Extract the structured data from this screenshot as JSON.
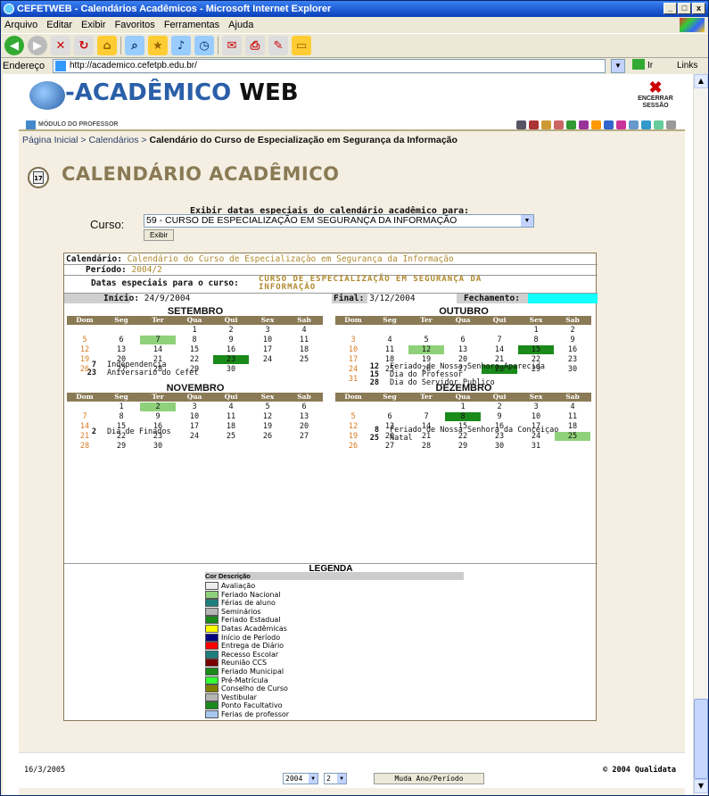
{
  "window": {
    "title": "CEFETWEB - Calendários Acadêmicos - Microsoft Internet Explorer",
    "controls": [
      "_",
      "□",
      "x"
    ]
  },
  "menu": [
    "Arquivo",
    "Editar",
    "Exibir",
    "Favoritos",
    "Ferramentas",
    "Ajuda"
  ],
  "address": {
    "label": "Endereço",
    "url": "http://academico.cefetpb.edu.br/",
    "go": "Ir",
    "links": "Links"
  },
  "header": {
    "logo_prefix": "-ACADÊMICO",
    "logo_suffix": "WEB",
    "logout_label": "ENCERRAR SESSÃO",
    "module": "MÓDULO DO PROFESSOR"
  },
  "breadcrumb": {
    "home": "Página Inicial",
    "sep1": ">",
    "calendars": "Calendários",
    "sep2": ">",
    "current": "Calendário do Curso de Especialização em Segurança da Informação"
  },
  "page_title": "CALENDÁRIO ACADÊMICO",
  "calendar_icon_text": "17",
  "filter": {
    "label": "Exibir datas especiais do calendário acadêmico para:",
    "course_label": "Curso:",
    "course_value": "59 - CURSO DE ESPECIALIZAÇÃO EM SEGURANÇA DA INFORMAÇÃO",
    "button": "Exibir"
  },
  "info": {
    "calendar_label": "Calendário:",
    "calendar_value": "Calendário do Curso de Especialização em Segurança da Informação",
    "period_label": "Período:",
    "period_value": "2004/2",
    "special_label": "Datas especiais para o curso:",
    "special_value": "CURSO DE ESPECIALIZAÇÃO EM SEGURANÇA DA INFORMAÇÃO",
    "start_label": "Início:",
    "start_value": "24/9/2004",
    "end_label": "Final:",
    "end_value": "3/12/2004",
    "close_label": "Fechamento:",
    "close_value": ""
  },
  "weekdays": [
    "Dom",
    "Seg",
    "Ter",
    "Qua",
    "Qui",
    "Sex",
    "Sab"
  ],
  "months": [
    {
      "name": "SETEMBRO",
      "weeks": [
        [
          "",
          "",
          "",
          "1",
          "2",
          "3",
          "4"
        ],
        [
          "5",
          "6",
          "7",
          "8",
          "9",
          "10",
          "11"
        ],
        [
          "12",
          "13",
          "14",
          "15",
          "16",
          "17",
          "18"
        ],
        [
          "19",
          "20",
          "21",
          "22",
          "23",
          "24",
          "25"
        ],
        [
          "26",
          "27",
          "28",
          "29",
          "30",
          "",
          ""
        ]
      ],
      "highlights": {
        "7": "light",
        "23": "dark"
      },
      "holidays": [
        {
          "day": "7",
          "desc": "Independencia"
        },
        {
          "day": "23",
          "desc": "Aniversario do Cefet"
        }
      ]
    },
    {
      "name": "OUTUBRO",
      "weeks": [
        [
          "",
          "",
          "",
          "",
          "",
          "1",
          "2"
        ],
        [
          "3",
          "4",
          "5",
          "6",
          "7",
          "8",
          "9"
        ],
        [
          "10",
          "11",
          "12",
          "13",
          "14",
          "15",
          "16"
        ],
        [
          "17",
          "18",
          "19",
          "20",
          "21",
          "22",
          "23"
        ],
        [
          "24",
          "25",
          "26",
          "27",
          "28",
          "29",
          "30"
        ],
        [
          "31",
          "",
          "",
          "",
          "",
          "",
          ""
        ]
      ],
      "highlights": {
        "12": "light",
        "15": "dark",
        "28": "dark"
      },
      "holidays": [
        {
          "day": "12",
          "desc": "Feriado de Nossa Senhora Aparecida"
        },
        {
          "day": "15",
          "desc": "Dia do Professor"
        },
        {
          "day": "28",
          "desc": "Dia do Servidor Publico"
        }
      ]
    },
    {
      "name": "NOVEMBRO",
      "weeks": [
        [
          "",
          "1",
          "2",
          "3",
          "4",
          "5",
          "6"
        ],
        [
          "7",
          "8",
          "9",
          "10",
          "11",
          "12",
          "13"
        ],
        [
          "14",
          "15",
          "16",
          "17",
          "18",
          "19",
          "20"
        ],
        [
          "21",
          "22",
          "23",
          "24",
          "25",
          "26",
          "27"
        ],
        [
          "28",
          "29",
          "30",
          "",
          "",
          "",
          ""
        ]
      ],
      "highlights": {
        "2": "light"
      },
      "holidays": [
        {
          "day": "2",
          "desc": "Dia de Finados"
        }
      ]
    },
    {
      "name": "DEZEMBRO",
      "weeks": [
        [
          "",
          "",
          "",
          "1",
          "2",
          "3",
          "4"
        ],
        [
          "5",
          "6",
          "7",
          "8",
          "9",
          "10",
          "11"
        ],
        [
          "12",
          "13",
          "14",
          "15",
          "16",
          "17",
          "18"
        ],
        [
          "19",
          "20",
          "21",
          "22",
          "23",
          "24",
          "25"
        ],
        [
          "26",
          "27",
          "28",
          "29",
          "30",
          "31",
          ""
        ]
      ],
      "highlights": {
        "8": "dark",
        "25": "light"
      },
      "holidays": [
        {
          "day": "8",
          "desc": "Feriado de Nossa Senhora da Conceiçao"
        },
        {
          "day": "25",
          "desc": "Natal"
        }
      ]
    }
  ],
  "legend": {
    "title": "LEGENDA",
    "col_color": "Cor",
    "col_desc": "Descrição",
    "items": [
      {
        "color": "#ededed",
        "label": "Avaliação"
      },
      {
        "color": "#8fd17a",
        "label": "Feriado Nacional"
      },
      {
        "color": "#1f7f7f",
        "label": "Férias de aluno"
      },
      {
        "color": "#b5b5b5",
        "label": "Seminários"
      },
      {
        "color": "#1a8a1a",
        "label": "Feriado Estadual"
      },
      {
        "color": "#ffff00",
        "label": "Datas Acadêmicas"
      },
      {
        "color": "#000080",
        "label": "Início de Período"
      },
      {
        "color": "#ff0000",
        "label": "Entrega de Diário"
      },
      {
        "color": "#1f7f7f",
        "label": "Recesso Escolar"
      },
      {
        "color": "#7a0000",
        "label": "Reunião CCS"
      },
      {
        "color": "#1a8a1a",
        "label": "Feriado Municipal"
      },
      {
        "color": "#33ff33",
        "label": "Pré-Matrícula"
      },
      {
        "color": "#808000",
        "label": "Conselho de Curso"
      },
      {
        "color": "#b5b5b5",
        "label": "Vestibular"
      },
      {
        "color": "#1a8a1a",
        "label": "Ponto Facultativo"
      },
      {
        "color": "#a6c8f0",
        "label": "Ferias de professor"
      }
    ]
  },
  "footer": {
    "date": "16/3/2005",
    "year": "2004",
    "period": "2",
    "button": "Muda Ano/Período",
    "copyright": "© 2004 Qualidata"
  }
}
